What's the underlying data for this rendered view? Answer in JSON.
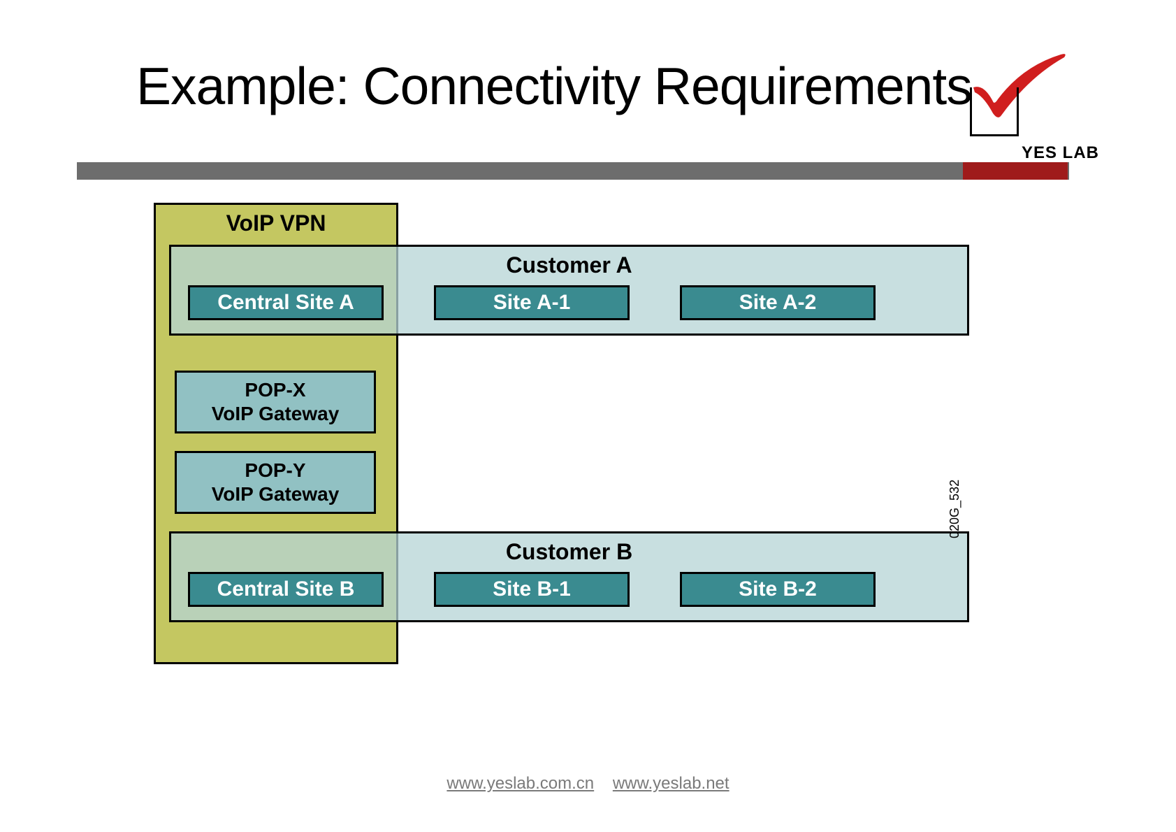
{
  "title": "Example: Connectivity Requirements",
  "logo": {
    "brand": "YES LAB"
  },
  "diagram": {
    "vpn_label": "VoIP VPN",
    "customer_a": {
      "label": "Customer A",
      "sites": [
        "Central Site A",
        "Site A-1",
        "Site A-2"
      ]
    },
    "customer_b": {
      "label": "Customer B",
      "sites": [
        "Central Site B",
        "Site B-1",
        "Site B-2"
      ]
    },
    "pop_x": {
      "line1": "POP-X",
      "line2": "VoIP Gateway"
    },
    "pop_y": {
      "line1": "POP-Y",
      "line2": "VoIP Gateway"
    },
    "slide_code": "020G_532"
  },
  "footer": {
    "link1": "www.yeslab.com.cn",
    "link2": "www.yeslab.net"
  }
}
